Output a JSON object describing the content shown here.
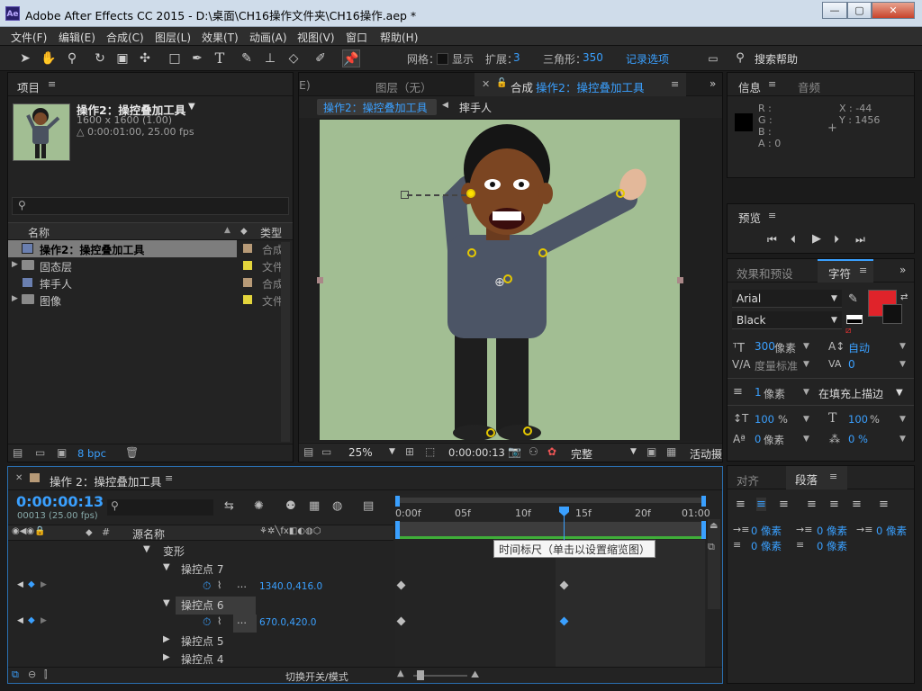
{
  "window": {
    "title": "Adobe After Effects CC 2015 - D:\\桌面\\CH16操作文件夹\\CH16操作.aep *",
    "app_icon": "Ae",
    "buttons": [
      "—",
      "▢",
      "✕"
    ]
  },
  "menu": [
    "文件(F)",
    "编辑(E)",
    "合成(C)",
    "图层(L)",
    "效果(T)",
    "动画(A)",
    "视图(V)",
    "窗口",
    "帮助(H)"
  ],
  "toolbar": {
    "grid_label": "网格：",
    "show_label": "显示",
    "expand_label": "扩展：",
    "expand_value": "3",
    "triangle_label": "三角形：",
    "triangle_value": "350",
    "record_options": "记录选项",
    "search_help": "搜索帮助"
  },
  "project": {
    "tab": "项目",
    "comp_name": "操作2：操控叠加工具",
    "comp_size": "1600 x 1600 (1.00)",
    "comp_duration": "△ 0:00:01:00, 25.00 fps",
    "search_placeholder": "",
    "col_name": "名称",
    "col_type": "类型",
    "items": [
      {
        "name": "操作2：操控叠加工具",
        "type": "合成",
        "label_color": "#b79a77",
        "icon": "comp-icon",
        "selected": true
      },
      {
        "name": "固态层",
        "type": "文件",
        "label_color": "#e3d53c",
        "icon": "folder-icon",
        "selected": false
      },
      {
        "name": "摔手人",
        "type": "合成",
        "label_color": "#b79a77",
        "icon": "comp-icon",
        "selected": false
      },
      {
        "name": "图像",
        "type": "文件",
        "label_color": "#e3d53c",
        "icon": "folder-icon",
        "selected": false
      }
    ],
    "bpc": "8 bpc"
  },
  "viewer": {
    "tab_cut": "E)",
    "tab_layer": "图层（无）",
    "tab_comp_prefix": "合成",
    "tab_comp_name": "操作2：操控叠加工具",
    "crumb_active": "操作2：操控叠加工具",
    "crumb_other": "摔手人",
    "zoom": "25%",
    "timecode": "0:00:00:13",
    "quality": "完整",
    "camera": "活动摄"
  },
  "info": {
    "tab": "信息",
    "tab2": "音频",
    "r": "R :",
    "g": "G :",
    "b": "B :",
    "a": "A : 0",
    "x": "X : -44",
    "y": "Y : 1456"
  },
  "preview": {
    "tab": "预览"
  },
  "character": {
    "tab_effects": "效果和预设",
    "tab_char": "字符",
    "font": "Arial",
    "style": "Black",
    "size_value": "300",
    "size_unit": "像素",
    "leading": "自动",
    "kerning": "度量标准",
    "tracking": "0",
    "stroke_value": "1",
    "stroke_unit": "像素",
    "stroke_mode": "在填充上描边",
    "vscale": "100",
    "hscale": "100",
    "pct": "%",
    "baseline_value": "0",
    "baseline_unit": "像素",
    "tsume": "0 %",
    "fill_color": "#e0232a"
  },
  "paragraph": {
    "tab_align": "对齐",
    "tab_para": "段落",
    "indent_values": [
      "0 像素",
      "0 像素",
      "0 像素",
      "0 像素",
      "0 像素"
    ]
  },
  "timeline": {
    "tab": "操作 2：操控叠加工具",
    "timecode": "0:00:00:13",
    "frames": "00013 (25.00 fps)",
    "col_source": "源名称",
    "ruler": [
      "0:00f",
      "05f",
      "10f",
      "15f",
      "20f",
      "01:00"
    ],
    "tooltip": "时间标尺（单击以设置缩览图）",
    "rows": [
      {
        "indent": 1,
        "arrow": "▼",
        "label": "变形",
        "value": ""
      },
      {
        "indent": 2,
        "arrow": "▼",
        "label": "操控点 7",
        "value": ""
      },
      {
        "indent": 3,
        "arrow": "",
        "label": "",
        "value": "1340.0,416.0"
      },
      {
        "indent": 2,
        "arrow": "▼",
        "label": "操控点 6",
        "value": ""
      },
      {
        "indent": 3,
        "arrow": "",
        "label": "",
        "value": "670.0,420.0"
      },
      {
        "indent": 2,
        "arrow": "▶",
        "label": "操控点 5",
        "value": ""
      },
      {
        "indent": 2,
        "arrow": "▶",
        "label": "操控点 4",
        "value": ""
      }
    ],
    "bottom_toggle": "切换开关/模式"
  }
}
